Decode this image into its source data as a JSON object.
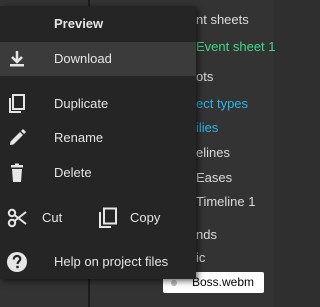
{
  "background": {
    "items": [
      "nt sheets",
      "Event sheet 1",
      "ots",
      "ect types",
      "ilies",
      "elines",
      "Eases",
      "Timeline 1",
      "nds",
      "ic"
    ],
    "file_name": "Boss.webm"
  },
  "menu": {
    "title": "Preview",
    "download": "Download",
    "duplicate": "Duplicate",
    "rename": "Rename",
    "delete": "Delete",
    "cut": "Cut",
    "copy": "Copy",
    "help": "Help on project files"
  },
  "colors": {
    "menu_bg": "#252525",
    "active_bg": "#3b3b3b",
    "text": "#e6e6e6",
    "green_text": "#3ddc84",
    "blue_text": "#2bb6e8"
  }
}
